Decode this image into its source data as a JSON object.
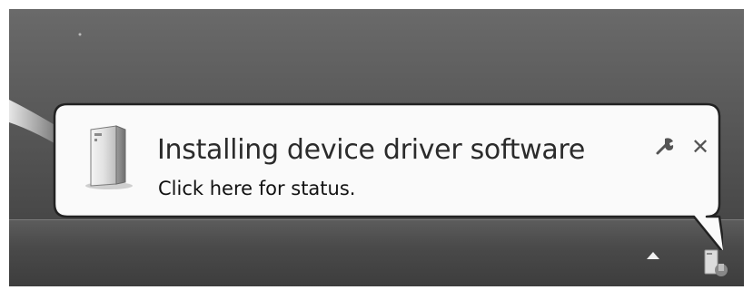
{
  "notification": {
    "title": "Installing device driver software",
    "message": "Click here for status.",
    "close_glyph": "✕",
    "device_icon": "device-tower-icon",
    "options_icon": "wrench-icon"
  },
  "tray": {
    "expand_icon": "show-hidden-icons-arrow",
    "device_icon": "device-install-tray-icon"
  },
  "colors": {
    "balloon_fill": "#fafafa",
    "balloon_border": "#222222",
    "text": "#2b2b2b"
  }
}
